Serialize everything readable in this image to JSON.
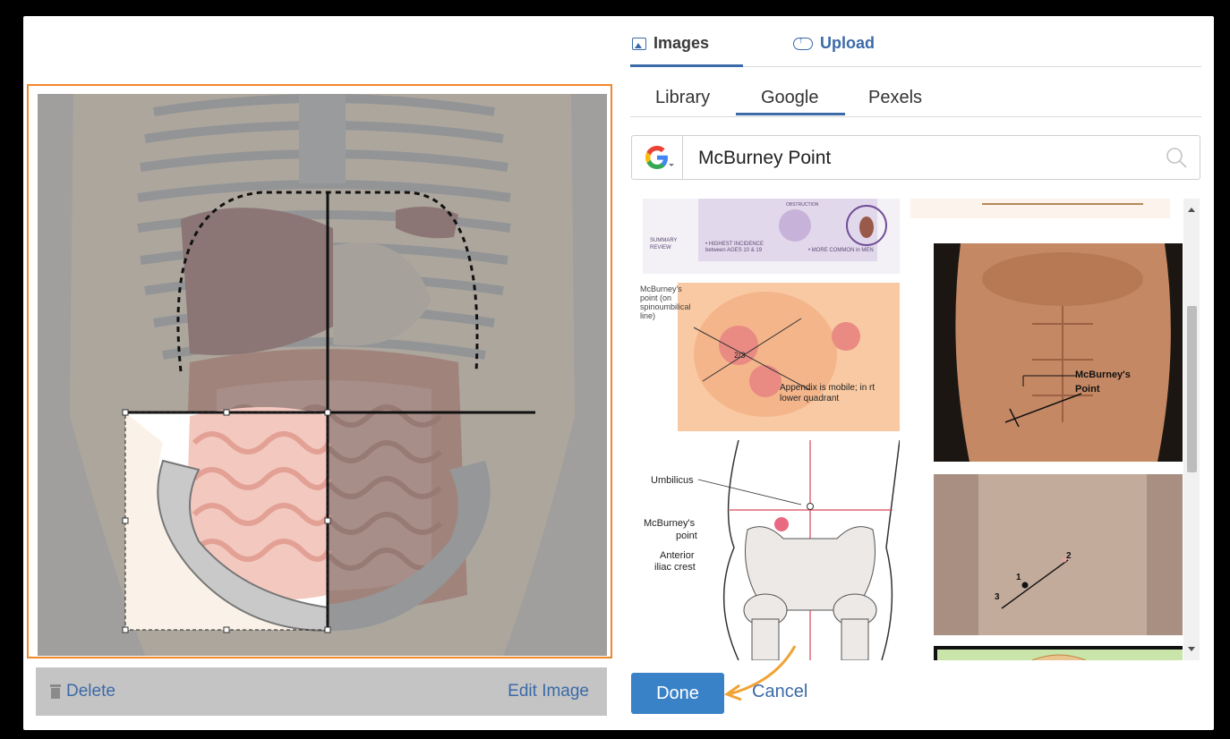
{
  "editor": {
    "delete_label": "Delete",
    "edit_label": "Edit Image"
  },
  "tabs": {
    "images_label": "Images",
    "upload_label": "Upload"
  },
  "sources": [
    "Library",
    "Google",
    "Pexels"
  ],
  "active_source": "Google",
  "search": {
    "value": "McBurney Point",
    "provider_icon": "google-g-icon"
  },
  "results": {
    "thumb1": {
      "lines": [
        "SUMMARY",
        "REVIEW",
        "• HIGHEST INCIDENCE",
        "between AGES 10 & 19",
        "• MORE COMMON in MEN",
        "OBSTRUCTION"
      ]
    },
    "thumb2": {
      "lines": [
        "McBurney's",
        "point (on",
        "spinoumbilical",
        "line)",
        "2/3",
        "Appendix is mobile; in rt",
        "lower quadrant"
      ]
    },
    "thumb3": {
      "lines": [
        "McBurney's",
        "Point"
      ]
    },
    "thumb4": {
      "lines": [
        "Umbilicus",
        "McBurney's",
        "point",
        "Anterior",
        "iliac crest"
      ]
    },
    "thumb5": {
      "lines": [
        "1",
        "2",
        "3"
      ]
    }
  },
  "actions": {
    "done_label": "Done",
    "cancel_label": "Cancel"
  },
  "colors": {
    "accent": "#3b6aa8",
    "done_bg": "#3a82c8",
    "selection_border": "#f0882b"
  }
}
